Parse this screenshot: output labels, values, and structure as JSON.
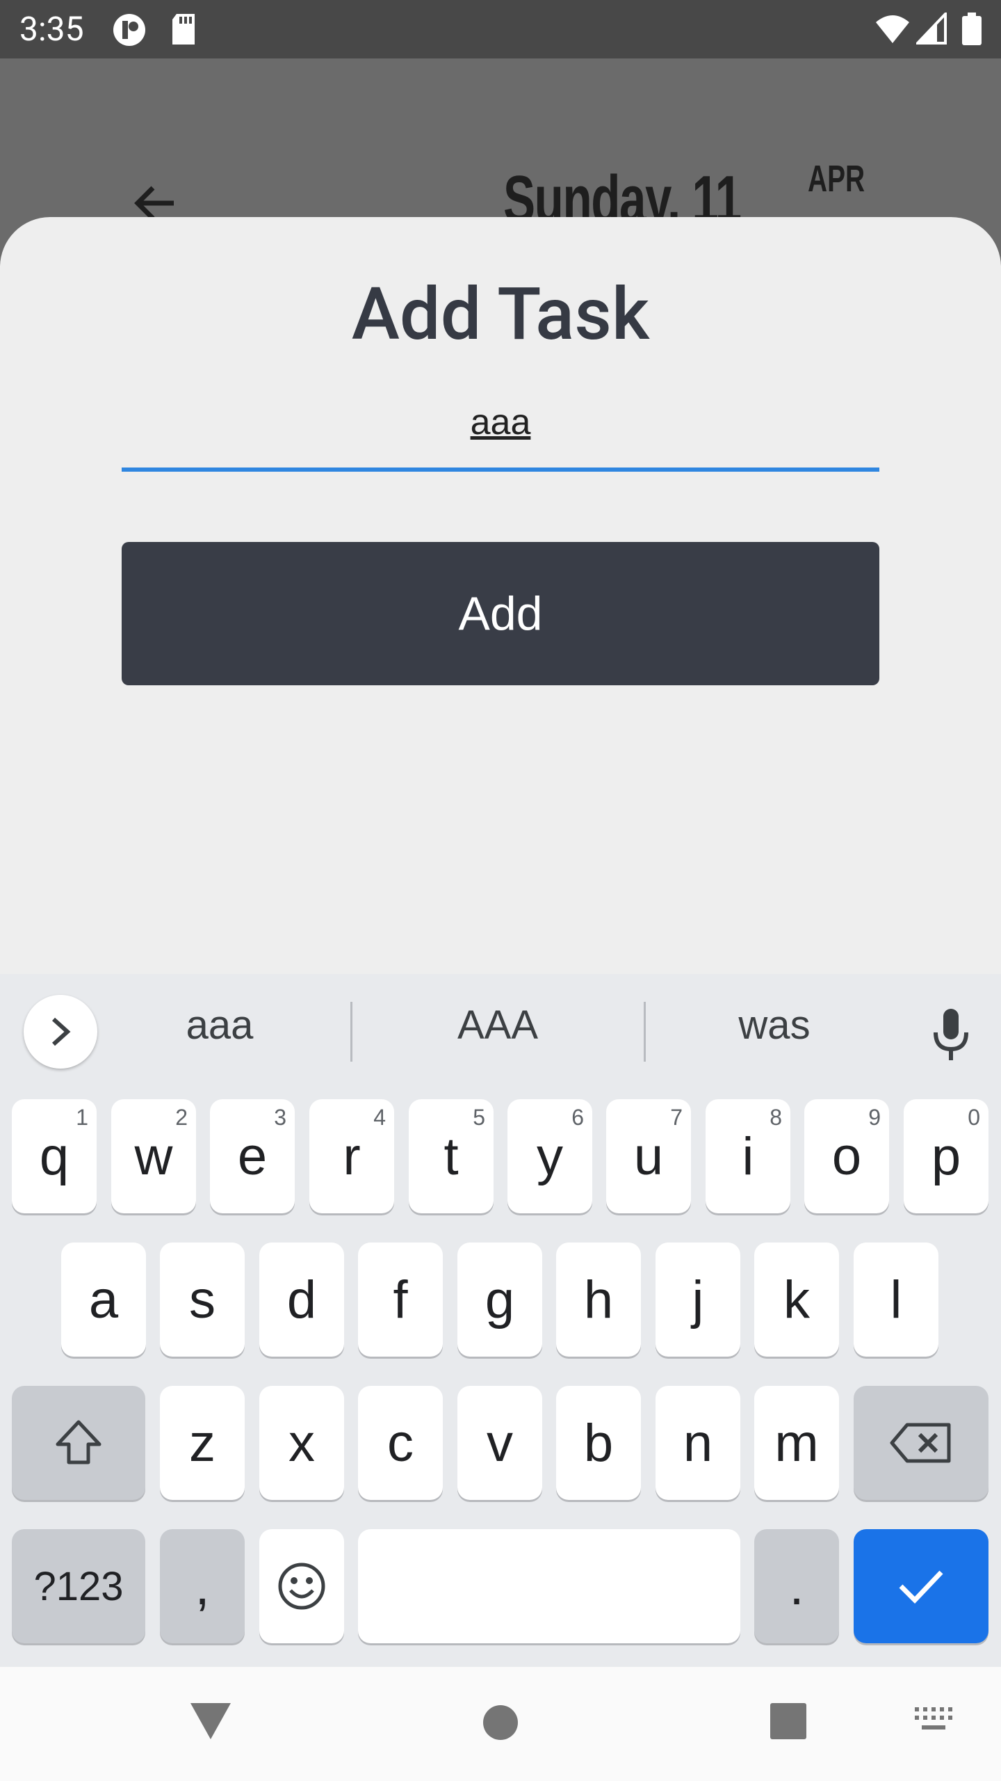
{
  "status_bar": {
    "time": "3:35"
  },
  "app": {
    "day_label": "Sunday, 11",
    "month": "APR"
  },
  "sheet": {
    "title": "Add Task",
    "input_value": "aaa",
    "button_label": "Add"
  },
  "keyboard": {
    "suggestions": [
      "aaa",
      "AAA",
      "was"
    ],
    "row1": [
      "q",
      "w",
      "e",
      "r",
      "t",
      "y",
      "u",
      "i",
      "o",
      "p"
    ],
    "row1_hints": [
      "1",
      "2",
      "3",
      "4",
      "5",
      "6",
      "7",
      "8",
      "9",
      "0"
    ],
    "row2": [
      "a",
      "s",
      "d",
      "f",
      "g",
      "h",
      "j",
      "k",
      "l"
    ],
    "row3": [
      "z",
      "x",
      "c",
      "v",
      "b",
      "n",
      "m"
    ],
    "symbols_label": "?123",
    "comma": ",",
    "period": "."
  }
}
